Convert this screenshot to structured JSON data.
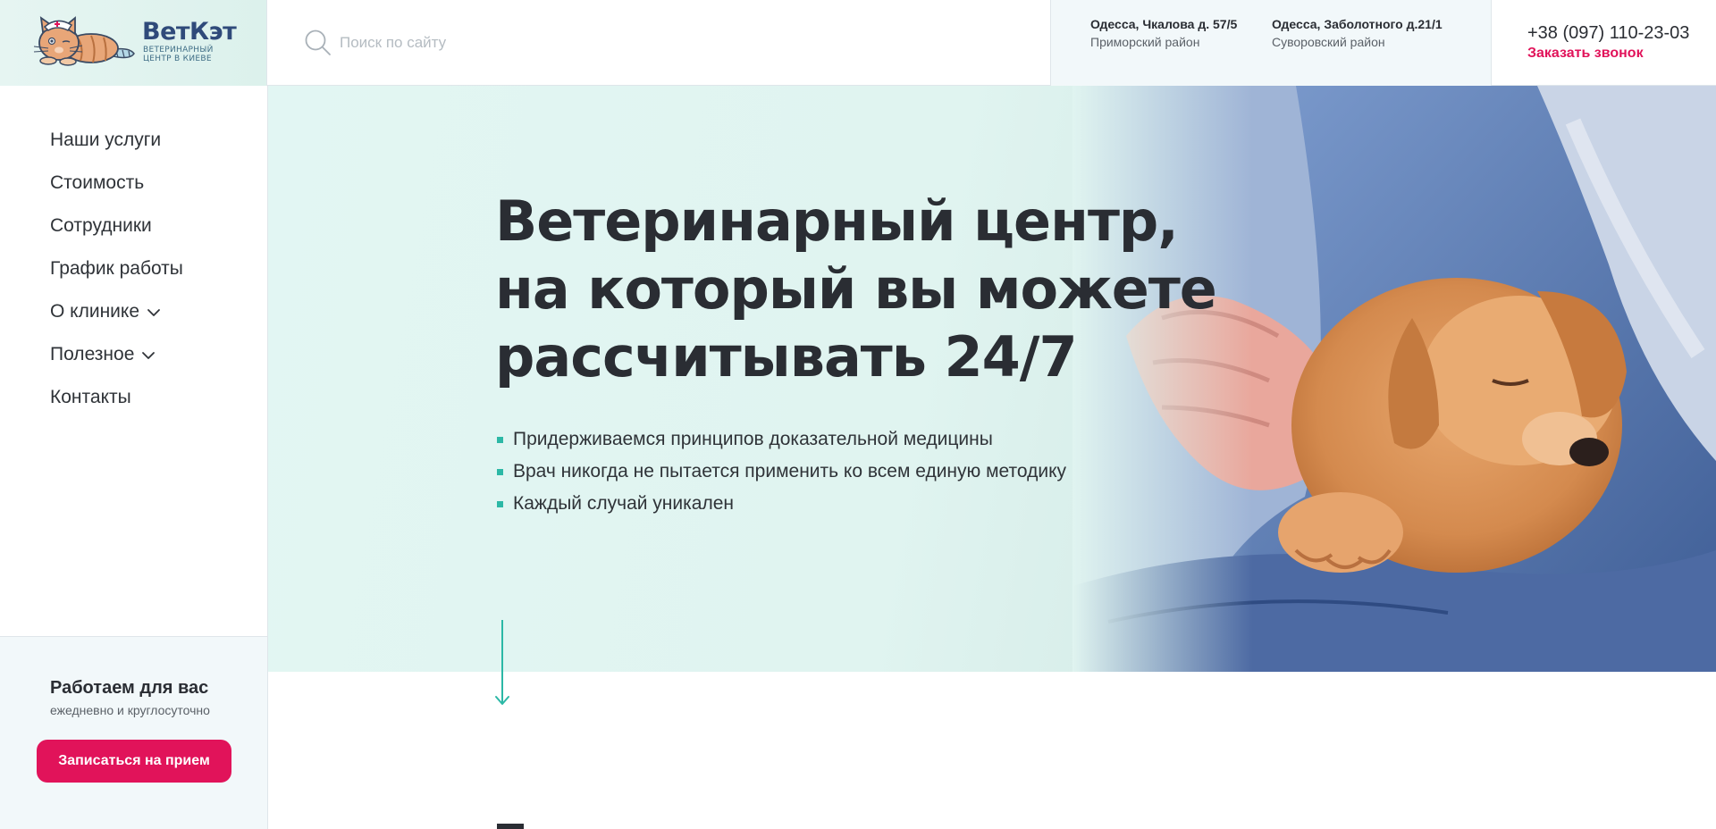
{
  "brand": {
    "name": "ВетКэт",
    "tagline": "Ветеринарный центр в Киеве"
  },
  "search": {
    "placeholder": "Поиск по сайту"
  },
  "addresses": [
    {
      "title": "Одесса, Чкалова д. 57/5",
      "district": "Приморский район"
    },
    {
      "title": "Одесса, Заболотного д.21/1",
      "district": "Суворовский район"
    }
  ],
  "contact": {
    "phone": "+38 (097) 110-23-03",
    "callback_label": "Заказать звонок"
  },
  "nav": {
    "items": [
      {
        "label": "Наши услуги"
      },
      {
        "label": "Стоимость"
      },
      {
        "label": "Сотрудники"
      },
      {
        "label": "График работы"
      },
      {
        "label": "О клинике",
        "has_dropdown": true
      },
      {
        "label": "Полезное",
        "has_dropdown": true
      },
      {
        "label": "Контакты"
      }
    ]
  },
  "schedule": {
    "title": "Работаем для вас",
    "subtitle": "ежедневно и круглосуточно",
    "book_label": "Записаться на прием"
  },
  "hero": {
    "title": "Ветеринарный центр, на который вы можете рассчитывать 24/7",
    "bullets": [
      "Придерживаемся принципов доказательной медицины",
      "Врач никогда не пытается применить ко всем единую методику",
      "Каждый случай уникален"
    ]
  },
  "colors": {
    "accent": "#e1135a",
    "teal": "#2cb8a6",
    "brand_blue": "#2f4a7a",
    "hero_bg": "#e2f6f3"
  },
  "icons": {
    "search": "search-icon",
    "chevron": "chevron-down-icon",
    "scroll": "arrow-down-icon",
    "logo": "cat-logo-icon"
  }
}
